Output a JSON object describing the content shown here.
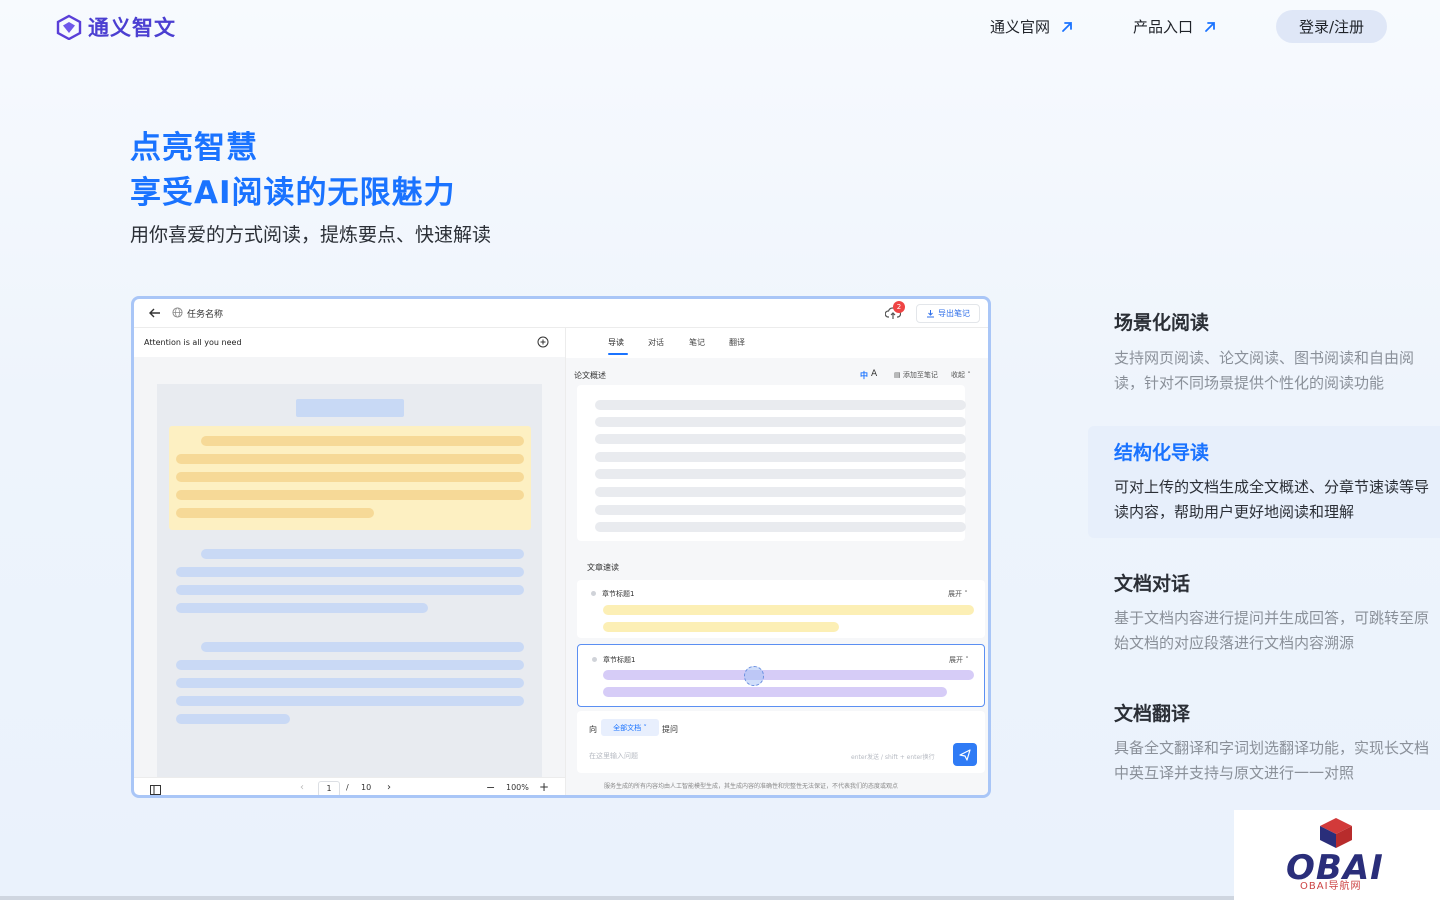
{
  "header": {
    "logo_text": "通义智文",
    "nav": [
      {
        "label": "通义官网"
      },
      {
        "label": "产品入口"
      }
    ],
    "login_label": "登录/注册"
  },
  "hero": {
    "title_line1": "点亮智慧",
    "title_line2": "享受AI阅读的无限魅力",
    "subtitle": "用你喜爱的方式阅读，提炼要点、快速解读"
  },
  "mock_app": {
    "task_name": "任务名称",
    "notification_count": "2",
    "export_label": "导出笔记",
    "doc_name": "Attention is all you need",
    "tabs": [
      "导读",
      "对话",
      "笔记",
      "翻译"
    ],
    "summary_title": "论文概述",
    "lang_zh": "中",
    "lang_en": "A",
    "add_note_label": "添加至笔记",
    "collapse_label": "收起",
    "speed_read_title": "文章速读",
    "chapters": [
      {
        "title": "章节标题1",
        "expand": "展开"
      },
      {
        "title": "章节标题1",
        "expand": "展开"
      }
    ],
    "ask_to": "向",
    "ask_scope": "全部文档",
    "ask_suffix": "提问",
    "input_placeholder": "在这里输入问题",
    "input_hint": "enter发送 / shift + enter换行",
    "disclaimer": "服务生成的所有内容均由人工智能模型生成，其生成内容的准确性和完整性无法保证，不代表我们的态度或观点",
    "page_current": "1",
    "page_sep": "/",
    "page_total": "10",
    "zoom": "100%"
  },
  "features": [
    {
      "title": "场景化阅读",
      "desc": "支持网页阅读、论文阅读、图书阅读和自由阅读，针对不同场景提供个性化的阅读功能",
      "active": false
    },
    {
      "title": "结构化导读",
      "desc": "可对上传的文档生成全文概述、分章节速读等导读内容，帮助用户更好地阅读和理解",
      "active": true
    },
    {
      "title": "文档对话",
      "desc": "基于文档内容进行提问并生成回答，可跳转至原始文档的对应段落进行文档内容溯源",
      "active": false
    },
    {
      "title": "文档翻译",
      "desc": "具备全文翻译和字词划选翻译功能，实现长文档中英互译并支持与原文进行一一对照",
      "active": false
    }
  ],
  "watermark": {
    "text": "OBAI",
    "sub": "OBAI导航网"
  },
  "colors": {
    "accent": "#1a73ff",
    "brand": "#4b3fd1"
  }
}
